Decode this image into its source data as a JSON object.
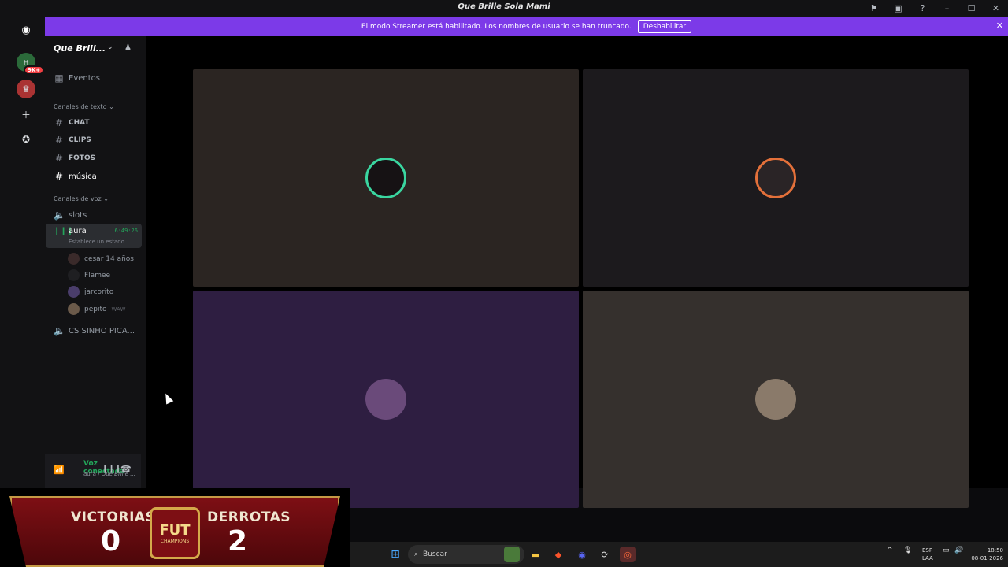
{
  "window": {
    "title": "Que Brille Sola Mami"
  },
  "banner": {
    "text": "El modo Streamer está habilitado. Los nombres de usuario se han truncado.",
    "button": "Deshabilitar"
  },
  "server": {
    "name": "Que Brill...",
    "badge": "9K+",
    "server_letter": "H"
  },
  "sidebar": {
    "events": "Eventos",
    "text_category": "Canales de texto",
    "text_channels": [
      "CHAT",
      "CLIPS",
      "FOTOS",
      "música"
    ],
    "voice_category": "Canales de voz",
    "voice_channels": [
      "slots",
      "aura",
      "CS SINHO PICA..."
    ],
    "aura_time": "6:49:26",
    "aura_status": "Establece un estado ...",
    "voice_users": [
      "cesar 14 años",
      "Flamee",
      "jarcorito",
      "pepito"
    ],
    "voice_users_extra": "WAW"
  },
  "voice_status": {
    "title": "Voz conectada",
    "subtitle_channel": "aura / ",
    "subtitle_server": "Que Brille ..."
  },
  "overlay": {
    "victorias_label": "VICTORIAS",
    "victorias": "0",
    "derrotas_label": "DERROTAS",
    "derrotas": "2",
    "fut": "FUT",
    "champions": "CHAMPIONS"
  },
  "taskbar": {
    "search": "Buscar",
    "lang": "ESP",
    "lang2": "LAA",
    "time": "18:50",
    "date": "08-01-2026"
  },
  "colors": {
    "accent": "#7c3ae8",
    "voice_green": "#23a55a"
  }
}
